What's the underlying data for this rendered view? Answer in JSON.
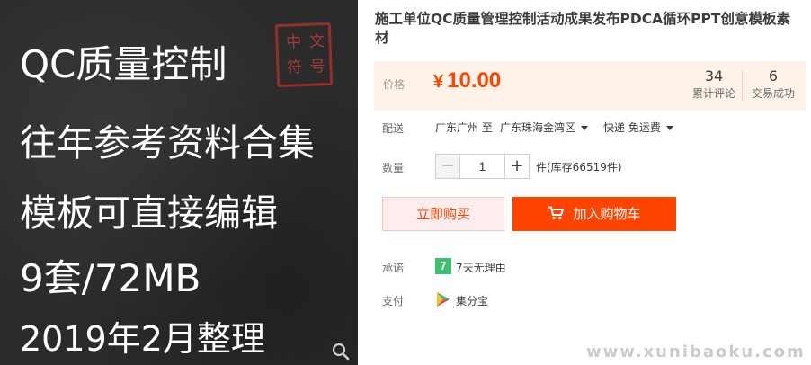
{
  "promo": {
    "line1": "QC质量控制",
    "line2": "往年参考资料合集",
    "line3": "模板可直接编辑",
    "line4": "9套/72MB",
    "line5": "2019年2月整理",
    "zoom_icon": "magnifier-icon"
  },
  "product": {
    "title": "施工单位QC质量管理控制活动成果发布PDCA循环PPT创意模板素材"
  },
  "price": {
    "label": "价格",
    "currency": "¥",
    "value": "10.00",
    "reviews_count": "34",
    "reviews_label": "累计评论",
    "sales_count": "6",
    "sales_label": "交易成功"
  },
  "shipping": {
    "label": "配送",
    "from": "广东广州 至",
    "to": "广东珠海金湾区",
    "method": "快递 免运费"
  },
  "quantity": {
    "label": "数量",
    "value": "1",
    "minus": "−",
    "plus": "+",
    "stock": "件(库存66519件)"
  },
  "actions": {
    "buy_now": "立即购买",
    "add_to_cart": "加入购物车"
  },
  "promise": {
    "label": "承诺",
    "icon_text": "7",
    "text": "7天无理由"
  },
  "payment": {
    "label": "支付",
    "text": "集分宝"
  },
  "watermark": "www.xunibaoku.com",
  "colors": {
    "accent": "#ff4400",
    "price_bg": "#fff2e8",
    "promise_green": "#3cbf6e"
  }
}
